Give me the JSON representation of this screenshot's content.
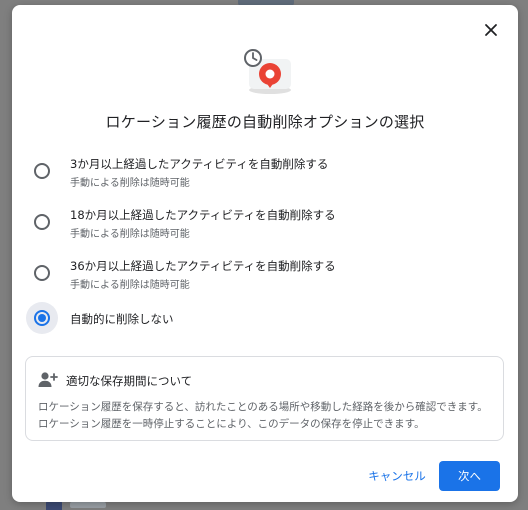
{
  "dialog": {
    "title": "ロケーション履歴の自動削除オプションの選択",
    "options": [
      {
        "label": "3か月以上経過したアクティビティを自動削除する",
        "sublabel": "手動による削除は随時可能",
        "selected": false
      },
      {
        "label": "18か月以上経過したアクティビティを自動削除する",
        "sublabel": "手動による削除は随時可能",
        "selected": false
      },
      {
        "label": "36か月以上経過したアクティビティを自動削除する",
        "sublabel": "手動による削除は随時可能",
        "selected": false
      },
      {
        "label": "自動的に削除しない",
        "selected": true
      }
    ],
    "info": {
      "title": "適切な保存期間について",
      "body": "ロケーション履歴を保存すると、訪れたことのある場所や移動した経路を後から確認できます。ロケーション履歴を一時停止することにより、このデータの保存を停止できます。"
    },
    "actions": {
      "cancel_label": "キャンセル",
      "next_label": "次へ"
    }
  },
  "icons": {
    "close": "close-icon",
    "illustration": "location-history-clock-icon",
    "info": "person-add-icon"
  },
  "colors": {
    "accent": "#1a73e8",
    "text_primary": "#202124",
    "text_secondary": "#5f6368",
    "illustration_red": "#ea4335"
  }
}
